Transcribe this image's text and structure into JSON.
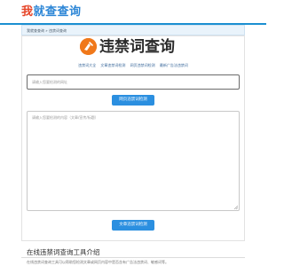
{
  "header": {
    "logo_part1": "我",
    "logo_part2": "就",
    "logo_part3": "查查询"
  },
  "breadcrumb": {
    "home": "我就查查询",
    "separator": " » ",
    "current": "违禁词查询"
  },
  "brand": {
    "title": "违禁词查询",
    "icon": "brand-logo-icon"
  },
  "nav": {
    "items": [
      "违禁词大全",
      "文章违禁词检测",
      "网页违禁词检测",
      "最新广告法违禁词"
    ]
  },
  "url_form": {
    "placeholder": "请输入您要检测的网址",
    "button_label": "网页违禁词检测"
  },
  "text_form": {
    "placeholder": "请输入您要检测的内容（文章/宣传/标题）",
    "button_label": "文章违禁词检测"
  },
  "intro": {
    "title": "在线违禁词查询工具介绍",
    "text": "在线违禁词查询工具可以帮助您检测文章或网页内容中是否含有广告法违禁词、敏感词等。"
  },
  "colors": {
    "accent": "#2b8fe0",
    "brand_orange": "#f0781a",
    "logo_red": "#e64528",
    "logo_blue": "#2c86d6"
  }
}
